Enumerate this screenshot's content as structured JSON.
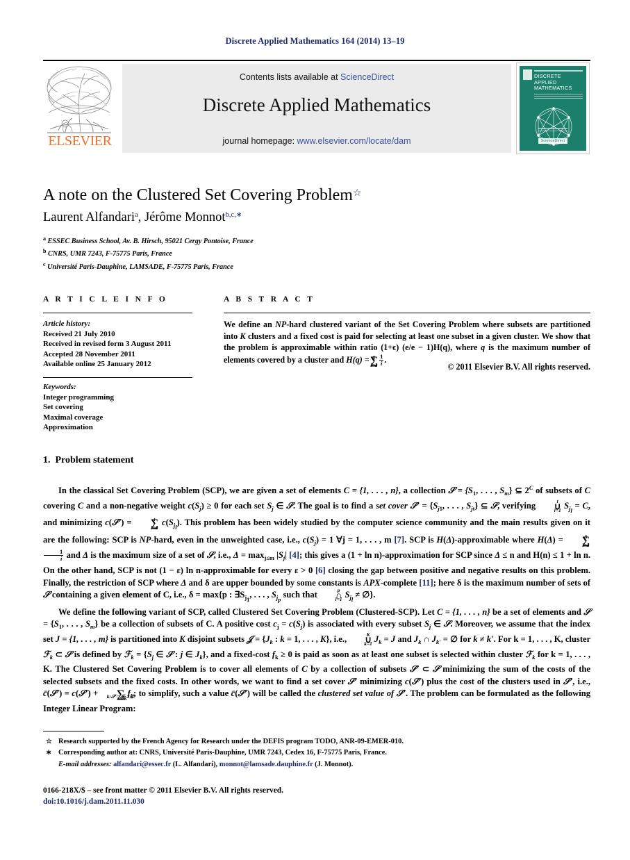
{
  "running_head": "Discrete Applied Mathematics 164 (2014) 13–19",
  "masthead": {
    "contents_prefix": "Contents lists available at ",
    "sciencedirect": "ScienceDirect",
    "journal_title": "Discrete Applied Mathematics",
    "homepage_prefix": "journal homepage: ",
    "homepage_url": "www.elsevier.com/locate/dam",
    "publisher_logo_text": "ELSEVIER",
    "cover": {
      "title_line1": "DISCRETE",
      "title_line2": "APPLIED",
      "title_line3": "MATHEMATICS",
      "badge": "ScienceDirect"
    },
    "colors": {
      "link": "#3a4fa0",
      "elsevier_orange": "#E8732A",
      "cover_teal": "#1c7f6b",
      "box_gray": "#ebebeb"
    }
  },
  "article": {
    "title": "A note on the Clustered Set Covering Problem",
    "title_mark": "☆",
    "authors": [
      {
        "name": "Laurent Alfandari",
        "marks": "a"
      },
      {
        "name": "Jérôme Monnot",
        "marks": "b,c,∗"
      }
    ],
    "affiliations": [
      {
        "mark": "a",
        "text": "ESSEC Business School, Av. B. Hirsch, 95021 Cergy Pontoise, France"
      },
      {
        "mark": "b",
        "text": "CNRS, UMR 7243, F-75775 Paris, France"
      },
      {
        "mark": "c",
        "text": "Université Paris-Dauphine, LAMSADE, F-75775 Paris, France"
      }
    ]
  },
  "info": {
    "heading": "A R T I C L E   I N F O",
    "history_label": "Article history:",
    "history": [
      "Received 21 July 2010",
      "Received in revised form 3 August 2011",
      "Accepted 28 November 2011",
      "Available online 25 January 2012"
    ],
    "keywords_label": "Keywords:",
    "keywords": [
      "Integer programming",
      "Set covering",
      "Maximal coverage",
      "Approximation"
    ]
  },
  "abstract": {
    "heading": "A B S T R A C T",
    "text_part1": "We define an ",
    "np_hard": "NP",
    "text_part2": "-hard clustered variant of the Set Covering Problem where subsets are partitioned into ",
    "k_sym": "K",
    "text_part3": " clusters and a fixed cost is paid for selecting at least one subset in a given cluster. We show that the problem is approximable within ratio ",
    "ratio": "(1+ϵ) (e/e − 1)H(q)",
    "text_part4": ", where ",
    "q_sym": "q",
    "text_part5": " is the maximum number of elements covered by a cluster and ",
    "hq": "H(q) =",
    "sum_upper": "q",
    "sum_lower": "i=1",
    "frac_num": "1",
    "frac_den": "i",
    "copyright": "© 2011 Elsevier B.V. All rights reserved."
  },
  "section": {
    "number": "1.",
    "title": "Problem statement"
  },
  "body": {
    "p1": {
      "s1": "In the classical Set Covering Problem (SCP), we are given a set of elements ",
      "c_def": "C = {1, . . . , n}",
      "s2": ", a collection ",
      "s_def": "= {S",
      "s3": " of subsets of ",
      "s4": " covering ",
      "s5": " and a non-negative weight ",
      "s6": " for each set ",
      "s7": ". The goal is to find a ",
      "setcover_it": "set cover",
      "s8": ", verifying ",
      "s9": ", and minimizing ",
      "s10": ". This problem has been widely studied by the computer science community and the main results given on it are the following: SCP is ",
      "nphard": "NP",
      "s11": "-hard, even in the unweighted case, i.e., ",
      "s12": " ∀j = 1, . . . , m ",
      "cite7": "[7]",
      "s13": ". SCP is ",
      "s14": "-approximable where ",
      "s15": " and ",
      "s16": " is the maximum size of a set of ",
      "s17": ", i.e., ",
      "cite4": "[4]",
      "s18": "; this gives a (1 + ln n)-approximation for SCP since ",
      "s19": " ≤ n and H(n) ≤ 1 + ln n. On the other hand, SCP is not (1 − ε) ln n-approximable for every ε > 0 ",
      "cite6": "[6]",
      "s20": " closing the gap between positive and negative results on this problem. Finally, the restriction of SCP where ",
      "s21": " and δ are upper bounded by some constants is ",
      "apx": "APX",
      "s22": "-complete ",
      "cite11": "[11]",
      "s23": "; here δ is the maximum number of sets of ",
      "s24": " containing a given element of C, i.e., δ = max{p : ∃S",
      "s25": " such that "
    },
    "p2": {
      "s1": "We define the following variant of SCP, called Clustered Set Covering Problem (Clustered-SCP). Let ",
      "c_def": "C = {1, . . . , n}",
      "s2": " be a set of elements and ",
      "s3": " be a collection of subsets of C. A positive cost ",
      "cost": "c",
      "s4": " is associated with every subset ",
      "s5": ". Moreover, we assume that the index set ",
      "jdef": "J = {1, . . . , m}",
      "s6": " is partitioned into ",
      "k": "K",
      "s7": " disjoint subsets ",
      "s8": ", i.e., ",
      "s9": " and ",
      "s10": " for ",
      "s11": ". For k = 1, . . . , K, cluster ",
      "s12": " is defined by ",
      "s13": ", and a fixed-cost ",
      "fk": "f",
      "s14": " ≥ 0 is paid as soon as at least one subset is selected within cluster ",
      "s15": " for k = 1, . . . , K. The Clustered Set Covering Problem is to cover all elements of ",
      "s16": " by a collection of subsets ",
      "s17": " minimizing the sum of the costs of the selected subsets and the fixed costs. In other words, we want to find a set cover ",
      "s18": " minimizing ",
      "s19": " plus the cost of the clusters used in ",
      "s20": ", i.e., ",
      "s21": "; to simplify, such a value ",
      "s22": " will be called the ",
      "csv_it": "clustered set value of",
      "s23": ". The problem can be formulated as the following Integer Linear Program:"
    }
  },
  "footnotes": [
    {
      "mark": "☆",
      "text": "Research supported by the French Agency for Research under the DEFIS program TODO, ANR-09-EMER-010."
    },
    {
      "mark": "∗",
      "text": "Corresponding author at: CNRS, Université Paris-Dauphine, UMR 7243, Cedex 16, F-75775 Paris, France."
    }
  ],
  "email_note": {
    "label": "E-mail addresses:",
    "email1": "alfandari@essec.fr",
    "name1": " (L. Alfandari), ",
    "email2": "monnot@lamsade.dauphine.fr",
    "name2": " (J. Monnot)."
  },
  "imprint": {
    "issn_line": "0166-218X/$ – see front matter © 2011 Elsevier B.V. All rights reserved.",
    "doi": "doi:10.1016/j.dam.2011.11.030"
  }
}
